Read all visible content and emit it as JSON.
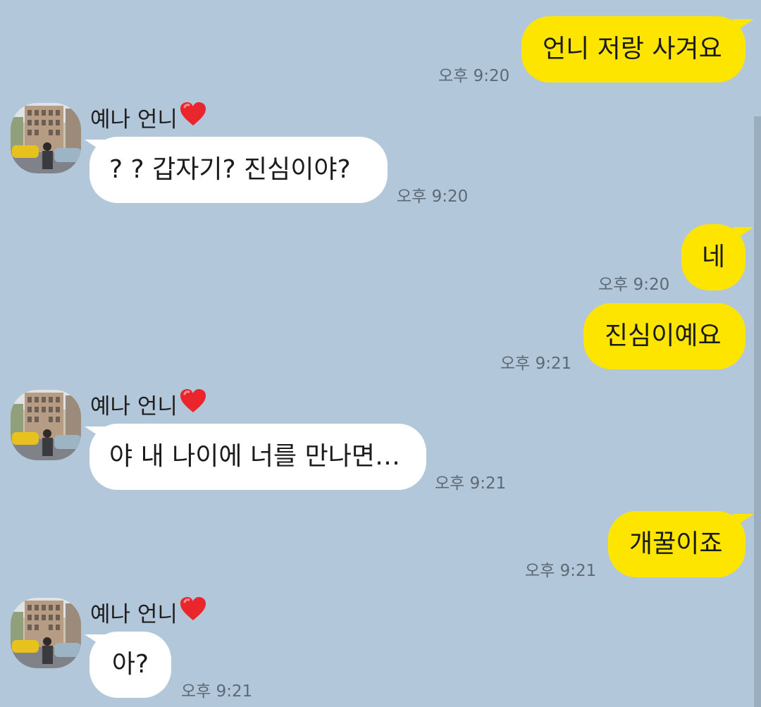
{
  "contact": {
    "name": "예나 언니",
    "name_emoji": "heart-icon"
  },
  "messages": [
    {
      "from": "me",
      "text": "언니 저랑 사겨요",
      "time": "오후 9:20"
    },
    {
      "from": "them",
      "text": "? ? 갑자기? 진심이야?",
      "time": "오후 9:20"
    },
    {
      "from": "me",
      "text": "네",
      "time": "오후 9:20"
    },
    {
      "from": "me",
      "text": "진심이예요",
      "time": "오후 9:21"
    },
    {
      "from": "them",
      "text": "야 내 나이에 너를 만나면…",
      "time": "오후 9:21"
    },
    {
      "from": "me",
      "text": "개꿀이죠",
      "time": "오후 9:21"
    },
    {
      "from": "them",
      "text": "아?",
      "time": "오후 9:21"
    }
  ],
  "colors": {
    "background": "#b2c7da",
    "my_bubble": "#fee500",
    "their_bubble": "#ffffff",
    "heart": "#e8262c"
  }
}
